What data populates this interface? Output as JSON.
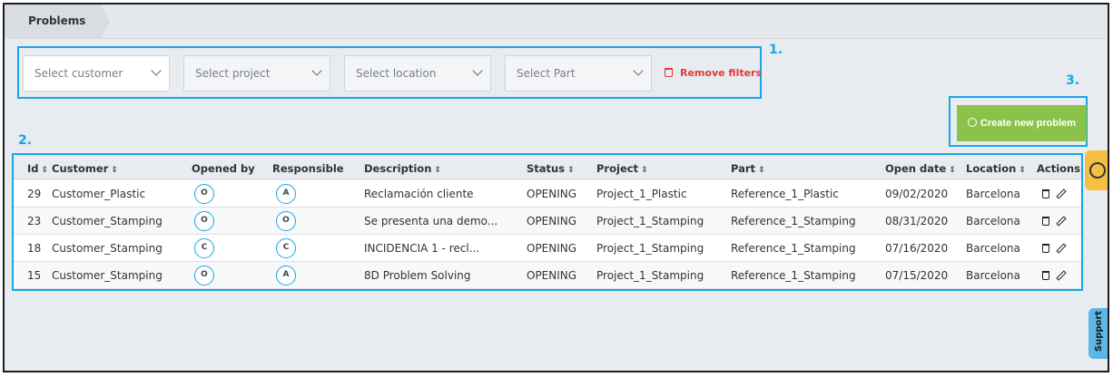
{
  "breadcrumb": {
    "title": "Problems"
  },
  "callouts": {
    "filters": "1.",
    "table": "2.",
    "create": "3."
  },
  "filters": {
    "customer": "Select customer",
    "project": "Select project",
    "location": "Select location",
    "part": "Select Part",
    "remove": "Remove filters"
  },
  "create_button": {
    "label": "Create new problem"
  },
  "table": {
    "columns": [
      "Id",
      "Customer",
      "Opened by",
      "Responsible",
      "Description",
      "Status",
      "Project",
      "Part",
      "Open date",
      "Location",
      "Actions"
    ],
    "rows": [
      {
        "id": "29",
        "customer": "Customer_Plastic",
        "opened_by": "O",
        "responsible": "A",
        "description": "Reclamación cliente",
        "status": "OPENING",
        "project": "Project_1_Plastic",
        "part": "Reference_1_Plastic",
        "open_date": "09/02/2020",
        "location": "Barcelona"
      },
      {
        "id": "23",
        "customer": "Customer_Stamping",
        "opened_by": "O",
        "responsible": "O",
        "description": "Se presenta una demo...",
        "status": "OPENING",
        "project": "Project_1_Stamping",
        "part": "Reference_1_Stamping",
        "open_date": "08/31/2020",
        "location": "Barcelona"
      },
      {
        "id": "18",
        "customer": "Customer_Stamping",
        "opened_by": "C",
        "responsible": "C",
        "description": "INCIDENCIA 1 - recl...",
        "status": "OPENING",
        "project": "Project_1_Stamping",
        "part": "Reference_1_Stamping",
        "open_date": "07/16/2020",
        "location": "Barcelona"
      },
      {
        "id": "15",
        "customer": "Customer_Stamping",
        "opened_by": "O",
        "responsible": "A",
        "description": "8D Problem Solving",
        "status": "OPENING",
        "project": "Project_1_Stamping",
        "part": "Reference_1_Stamping",
        "open_date": "07/15/2020",
        "location": "Barcelona"
      }
    ]
  },
  "support": {
    "label": "Support"
  },
  "icons": {
    "sort": "sort-icon",
    "trash": "trash-icon",
    "edit": "pencil-icon",
    "feedback": "smiley-icon"
  },
  "colors": {
    "accent": "#17a7e6",
    "create": "#8bc34a",
    "remove": "#e53935",
    "feedback": "#f5c041",
    "support": "#5cb6e8"
  }
}
